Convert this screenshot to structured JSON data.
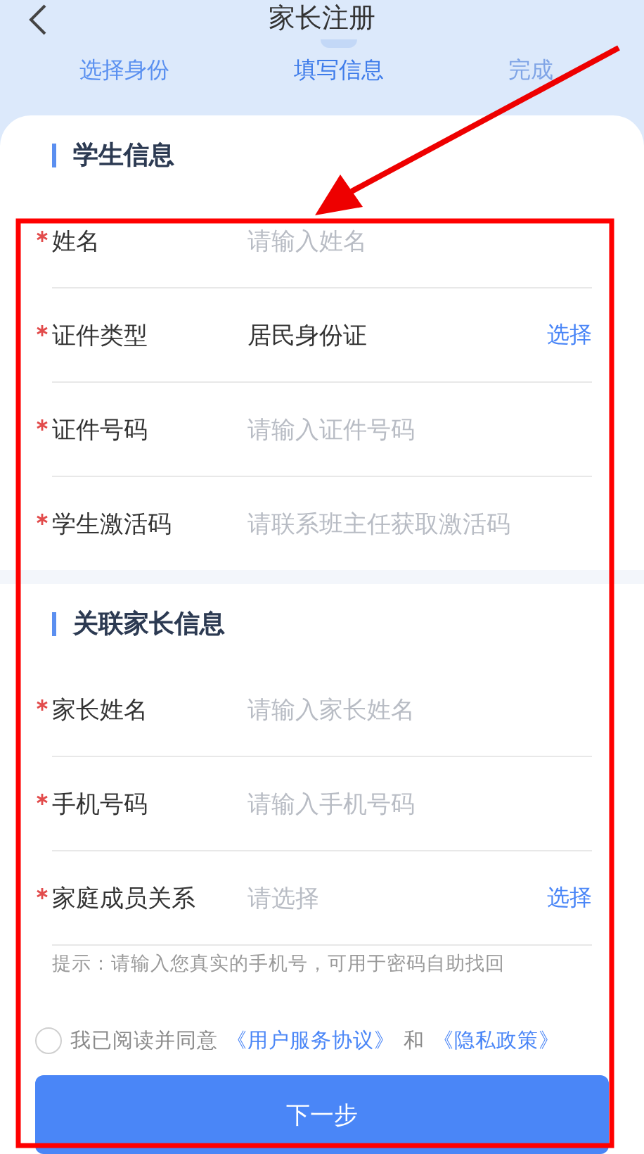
{
  "header": {
    "title": "家长注册"
  },
  "steps": [
    {
      "label": "选择身份",
      "selected": false,
      "completed": true
    },
    {
      "label": "填写信息",
      "selected": true,
      "completed": false
    },
    {
      "label": "完成",
      "selected": false,
      "completed": false
    }
  ],
  "sections": [
    {
      "title": "学生信息",
      "fields": [
        {
          "label": "姓名",
          "required": true,
          "kind": "input",
          "placeholder": "请输入姓名"
        },
        {
          "label": "证件类型",
          "required": true,
          "kind": "select",
          "value": "居民身份证",
          "action": "选择"
        },
        {
          "label": "证件号码",
          "required": true,
          "kind": "input",
          "placeholder": "请输入证件号码"
        },
        {
          "label": "学生激活码",
          "required": true,
          "kind": "input",
          "placeholder": "请联系班主任获取激活码"
        }
      ]
    },
    {
      "title": "关联家长信息",
      "fields": [
        {
          "label": "家长姓名",
          "required": true,
          "kind": "input",
          "placeholder": "请输入家长姓名"
        },
        {
          "label": "手机号码",
          "required": true,
          "kind": "input",
          "placeholder": "请输入手机号码"
        },
        {
          "label": "家庭成员关系",
          "required": true,
          "kind": "select",
          "placeholder": "请选择",
          "action": "选择"
        }
      ]
    }
  ],
  "hint": "提示：请输入您真实的手机号，可用于密码自助找回",
  "agreement": {
    "checked": false,
    "text": "我已阅读并同意",
    "link_1": "《用户服务协议》",
    "conjunction": "和",
    "link_2": "《隐私政策》"
  },
  "submit_button": "下一步"
}
